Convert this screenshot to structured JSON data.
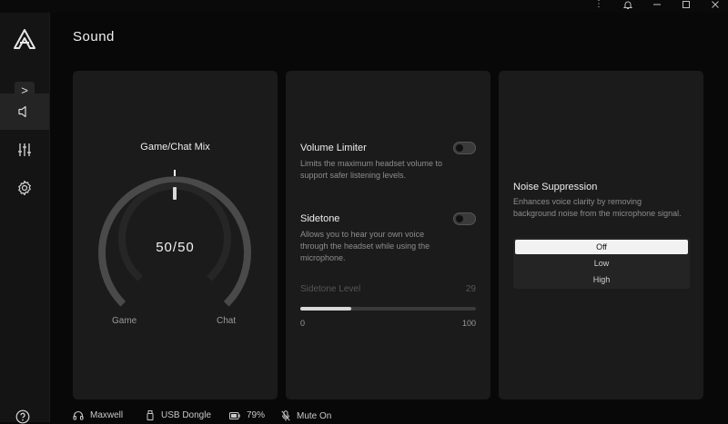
{
  "page": {
    "title": "Sound"
  },
  "titlebar": {
    "menu_icon": "more-vertical-icon",
    "bell_icon": "bell-icon",
    "minimize_icon": "minimize-icon",
    "maximize_icon": "maximize-icon",
    "close_icon": "close-icon"
  },
  "sidebar": {
    "expand_glyph": ">",
    "items": [
      {
        "name": "sound",
        "icon": "speaker-icon",
        "active": true
      },
      {
        "name": "equalizer",
        "icon": "sliders-icon",
        "active": false
      },
      {
        "name": "settings",
        "icon": "gear-icon",
        "active": false
      }
    ],
    "help_icon": "help-icon"
  },
  "mix": {
    "title": "Game/Chat Mix",
    "value_text": "50/50",
    "game_label": "Game",
    "chat_label": "Chat",
    "game": 50,
    "chat": 50
  },
  "volume_limiter": {
    "title": "Volume Limiter",
    "description": "Limits the maximum headset volume to support safer listening levels.",
    "enabled": false
  },
  "sidetone": {
    "title": "Sidetone",
    "description": "Allows you to hear your own voice through the headset while using the microphone.",
    "enabled": false,
    "level_label": "Sidetone Level",
    "level_value": "29",
    "level": 29,
    "min": "0",
    "max": "100"
  },
  "noise_suppression": {
    "title": "Noise Suppression",
    "description": "Enhances voice clarity by removing background noise from the microphone signal.",
    "options": [
      "Off",
      "Low",
      "High"
    ],
    "selected": "Off"
  },
  "status": {
    "device": "Maxwell",
    "connection": "USB Dongle",
    "battery": "79%",
    "mic": "Mute On"
  },
  "colors": {
    "background": "#080808",
    "card": "#1b1b1b",
    "accent": "#f2f2f2"
  }
}
